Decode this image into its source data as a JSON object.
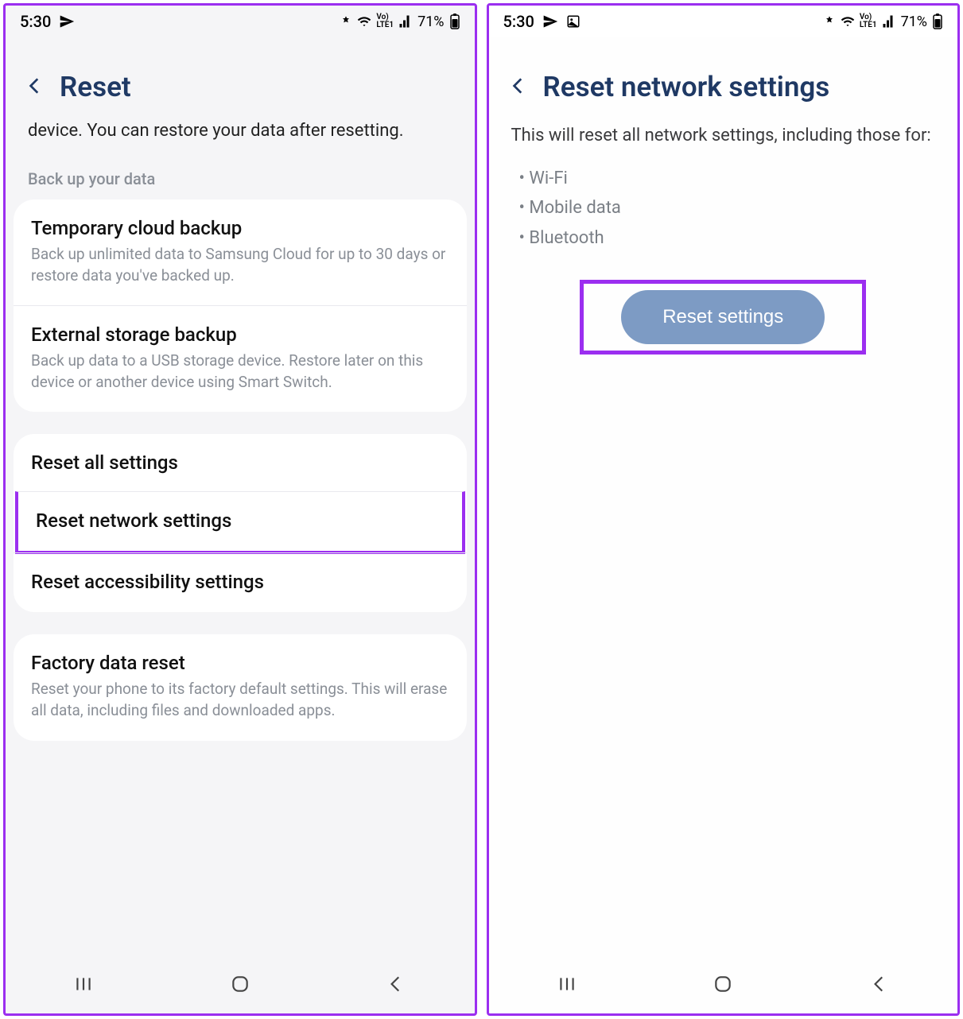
{
  "status": {
    "time": "5:30",
    "battery": "71%",
    "lte": "LTE1"
  },
  "screen1": {
    "title": "Reset",
    "intro": "device. You can restore your data after resetting.",
    "section_label": "Back up your data",
    "backup": [
      {
        "title": "Temporary cloud backup",
        "desc": "Back up unlimited data to Samsung Cloud for up to 30 days or restore data you've backed up."
      },
      {
        "title": "External storage backup",
        "desc": "Back up data to a USB storage device. Restore later on this device or another device using Smart Switch."
      }
    ],
    "resets": [
      {
        "title": "Reset all settings"
      },
      {
        "title": "Reset network settings"
      },
      {
        "title": "Reset accessibility settings"
      }
    ],
    "factory": {
      "title": "Factory data reset",
      "desc": "Reset your phone to its factory default settings. This will erase all data, including files and downloaded apps."
    }
  },
  "screen2": {
    "title": "Reset network settings",
    "intro": "This will reset all network settings, including those for:",
    "bullets": [
      "Wi-Fi",
      "Mobile data",
      "Bluetooth"
    ],
    "button": "Reset settings"
  }
}
